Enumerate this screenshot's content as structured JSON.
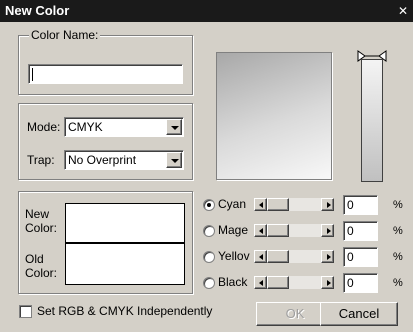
{
  "dialog": {
    "title": "New Color",
    "close_glyph": "✕"
  },
  "color_name": {
    "legend": "Color Name:",
    "value": ""
  },
  "mode": {
    "label": "Mode:",
    "value": "CMYK"
  },
  "trap": {
    "label": "Trap:",
    "value": "No Overprint"
  },
  "swatches": {
    "new_label": "New Color:",
    "old_label": "Old Color:"
  },
  "channels": [
    {
      "label": "Cyan",
      "value": "0",
      "selected": true
    },
    {
      "label": "Mage",
      "value": "0",
      "selected": false
    },
    {
      "label": "Yellov",
      "value": "0",
      "selected": false
    },
    {
      "label": "Black",
      "value": "0",
      "selected": false
    }
  ],
  "percent_symbol": "%",
  "independent_checkbox": {
    "label": "Set RGB & CMYK Independently",
    "checked": false
  },
  "buttons": {
    "ok": "OK",
    "cancel": "Cancel"
  },
  "icons": {
    "close": "close-icon",
    "dropdown": "chevron-down-icon",
    "scroll_left": "arrow-left-icon",
    "scroll_right": "arrow-right-icon",
    "brightness": "triangle-marker-icon"
  },
  "colors": {
    "titlebar": "#1a1a1a",
    "dialog_bg": "#d4d0c8"
  }
}
